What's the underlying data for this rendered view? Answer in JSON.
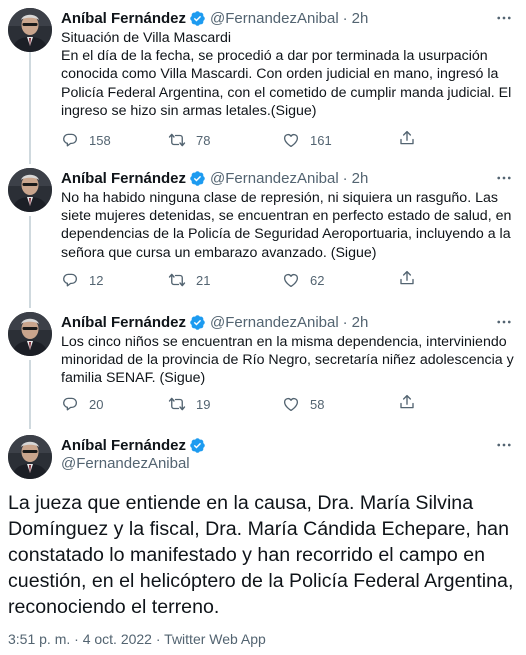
{
  "author": {
    "name": "Aníbal Fernández",
    "handle": "@FernandezAnibal",
    "verified_color": "#1d9bf0"
  },
  "tweets": [
    {
      "time": "2h",
      "lines": [
        "Situación de Villa Mascardi",
        "En el día de la fecha, se procedió a dar por terminada la usurpación conocida como Villa Mascardi. Con orden judicial en mano, ingresó la Policía Federal Argentina, con el cometido de cumplir manda judicial. El ingreso se hizo sin armas letales.(Sigue)"
      ],
      "replies": "158",
      "retweets": "78",
      "likes": "161"
    },
    {
      "time": "2h",
      "lines": [
        "No ha habido ninguna clase de represión, ni siquiera un rasguño. Las siete mujeres detenidas, se encuentran en perfecto estado de salud, en dependencias de la Policía de Seguridad Aeroportuaria, incluyendo a la señora que cursa un embarazo avanzado. (Sigue)"
      ],
      "replies": "12",
      "retweets": "21",
      "likes": "62"
    },
    {
      "time": "2h",
      "lines": [
        "Los cinco niños se encuentran en la misma dependencia, interviniendo minoridad de la provincia de Río Negro, secretaría niñez adolescencia y familia SENAF. (Sigue)"
      ],
      "replies": "20",
      "retweets": "19",
      "likes": "58"
    }
  ],
  "main_tweet": {
    "text": "La jueza que entiende en la causa, Dra. María Silvina Domínguez y la fiscal, Dra. María Cándida Echepare, han constatado lo manifestado y han recorrido el campo en cuestión, en el helicóptero de la Policía Federal Argentina, reconociendo el terreno.",
    "meta": "3:51 p. m. · 4 oct. 2022 · Twitter Web App"
  },
  "dot_separator": "·"
}
